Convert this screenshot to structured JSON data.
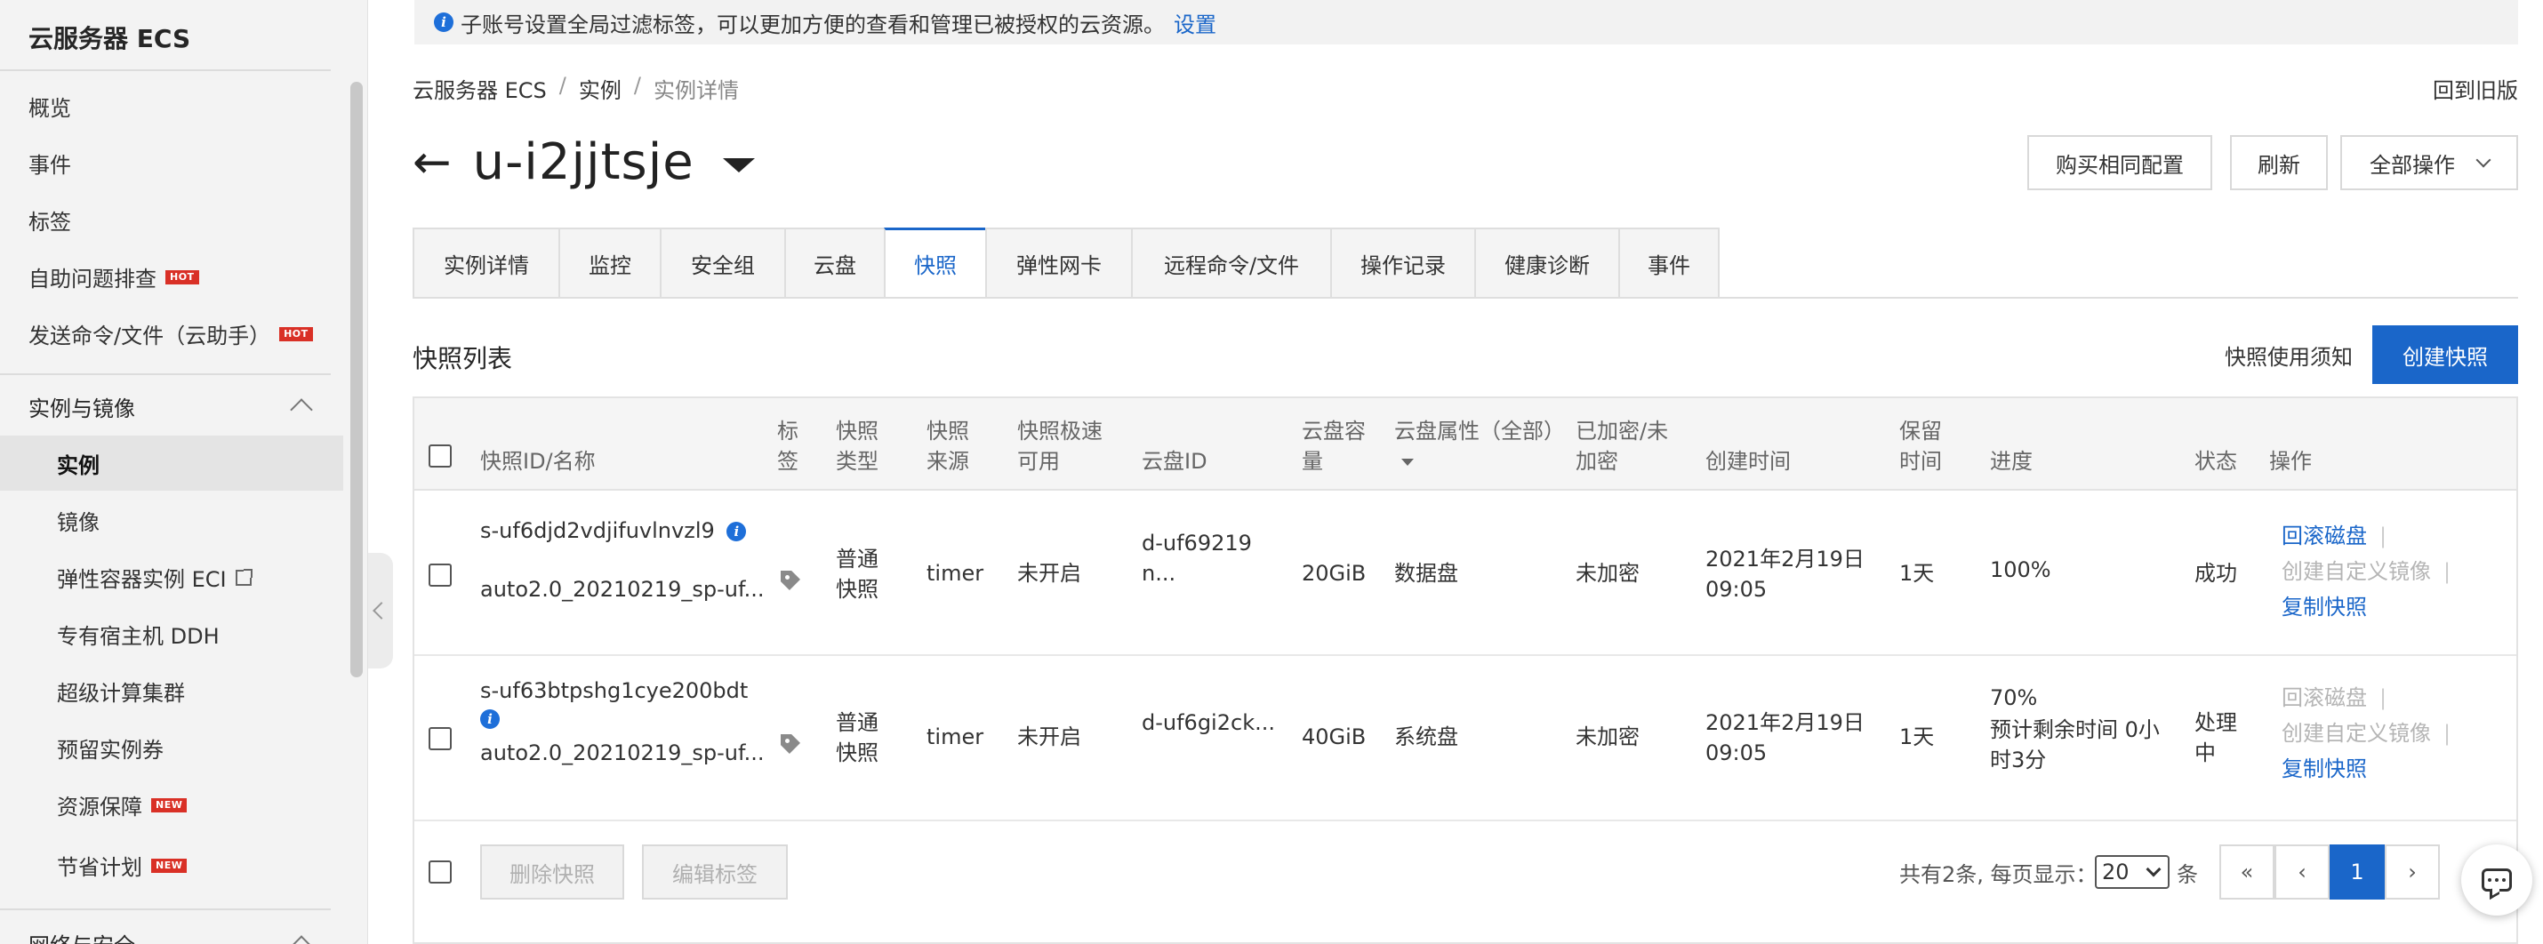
{
  "sidebar": {
    "title": "云服务器 ECS",
    "items": [
      {
        "label": "概览"
      },
      {
        "label": "事件"
      },
      {
        "label": "标签"
      },
      {
        "label": "自助问题排查",
        "badge": "HOT"
      },
      {
        "label": "发送命令/文件（云助手）",
        "badge": "HOT"
      }
    ],
    "group": {
      "label": "实例与镜像"
    },
    "sub_items": [
      {
        "label": "实例",
        "active": true
      },
      {
        "label": "镜像"
      },
      {
        "label": "弹性容器实例 ECI",
        "external": true
      },
      {
        "label": "专有宿主机 DDH"
      },
      {
        "label": "超级计算集群"
      },
      {
        "label": "预留实例券"
      },
      {
        "label": "资源保障",
        "badge": "NEW"
      },
      {
        "label": "节省计划",
        "badge": "NEW"
      }
    ],
    "next_group": {
      "label": "网络与安全"
    }
  },
  "notice": {
    "text": "子账号设置全局过滤标签，可以更加方便的查看和管理已被授权的云资源。",
    "link": "设置"
  },
  "breadcrumb": [
    "云服务器 ECS",
    "实例",
    "实例详情"
  ],
  "old_version_link": "回到旧版",
  "instance": {
    "title": "u-i2jjtsje"
  },
  "header_buttons": {
    "buy_same": "购买相同配置",
    "refresh": "刷新",
    "all_actions": "全部操作"
  },
  "tabs": [
    {
      "label": "实例详情"
    },
    {
      "label": "监控"
    },
    {
      "label": "安全组"
    },
    {
      "label": "云盘"
    },
    {
      "label": "快照",
      "active": true
    },
    {
      "label": "弹性网卡"
    },
    {
      "label": "远程命令/文件"
    },
    {
      "label": "操作记录"
    },
    {
      "label": "健康诊断"
    },
    {
      "label": "事件"
    }
  ],
  "snapshot_list": {
    "title": "快照列表",
    "notes_link": "快照使用须知",
    "create_button": "创建快照"
  },
  "table": {
    "headers": {
      "id_name": "快照ID/名称",
      "tag": "标签",
      "type": "快照类型",
      "source": "快照来源",
      "speed": "快照极速可用",
      "disk_id": "云盘ID",
      "capacity": "云盘容量",
      "disk_attr": "云盘属性（全部）",
      "encrypted": "已加密/未加密",
      "created": "创建时间",
      "retention": "保留时间",
      "progress": "进度",
      "status": "状态",
      "ops": "操作"
    },
    "rows": [
      {
        "id": "s-uf6djd2vdjifuvlnvzl9",
        "name": "auto2.0_20210219_sp-uf...",
        "type": "普通快照",
        "source": "timer",
        "speed": "未开启",
        "disk_id": "d-uf69219n...",
        "capacity": "20GiB",
        "disk_attr": "数据盘",
        "encrypted": "未加密",
        "created": "2021年2月19日 09:05",
        "retention": "1天",
        "progress": "100%",
        "progress_extra": "",
        "status": "成功",
        "op_rollback": "回滚磁盘",
        "op_custom_image": "创建自定义镜像",
        "op_copy": "复制快照"
      },
      {
        "id": "s-uf63btpshg1cye200bdt",
        "name": "auto2.0_20210219_sp-uf...",
        "type": "普通快照",
        "source": "timer",
        "speed": "未开启",
        "disk_id": "d-uf6gi2ck...",
        "capacity": "40GiB",
        "disk_attr": "系统盘",
        "encrypted": "未加密",
        "created": "2021年2月19日 09:05",
        "retention": "1天",
        "progress": "70%",
        "progress_extra": "预计剩余时间 0小时3分",
        "status": "处理中",
        "op_rollback": "回滚磁盘",
        "op_custom_image": "创建自定义镜像",
        "op_copy": "复制快照"
      }
    ]
  },
  "footer": {
    "delete_button": "删除快照",
    "edit_tags_button": "编辑标签",
    "total_text": "共有2条, 每页显示：",
    "page_size": "20",
    "unit": "条",
    "pages": {
      "first": "«",
      "prev": "‹",
      "current": "1",
      "next": "›"
    }
  },
  "colors": {
    "primary": "#1a66c9",
    "hot_badge": "#d93026",
    "sidebar_bg": "#f3f3f3"
  },
  "icons": [
    "info-icon",
    "back-arrow-icon",
    "caret-down-icon",
    "tag-icon",
    "external-link-icon",
    "chat-icon",
    "chevron-up-icon"
  ]
}
